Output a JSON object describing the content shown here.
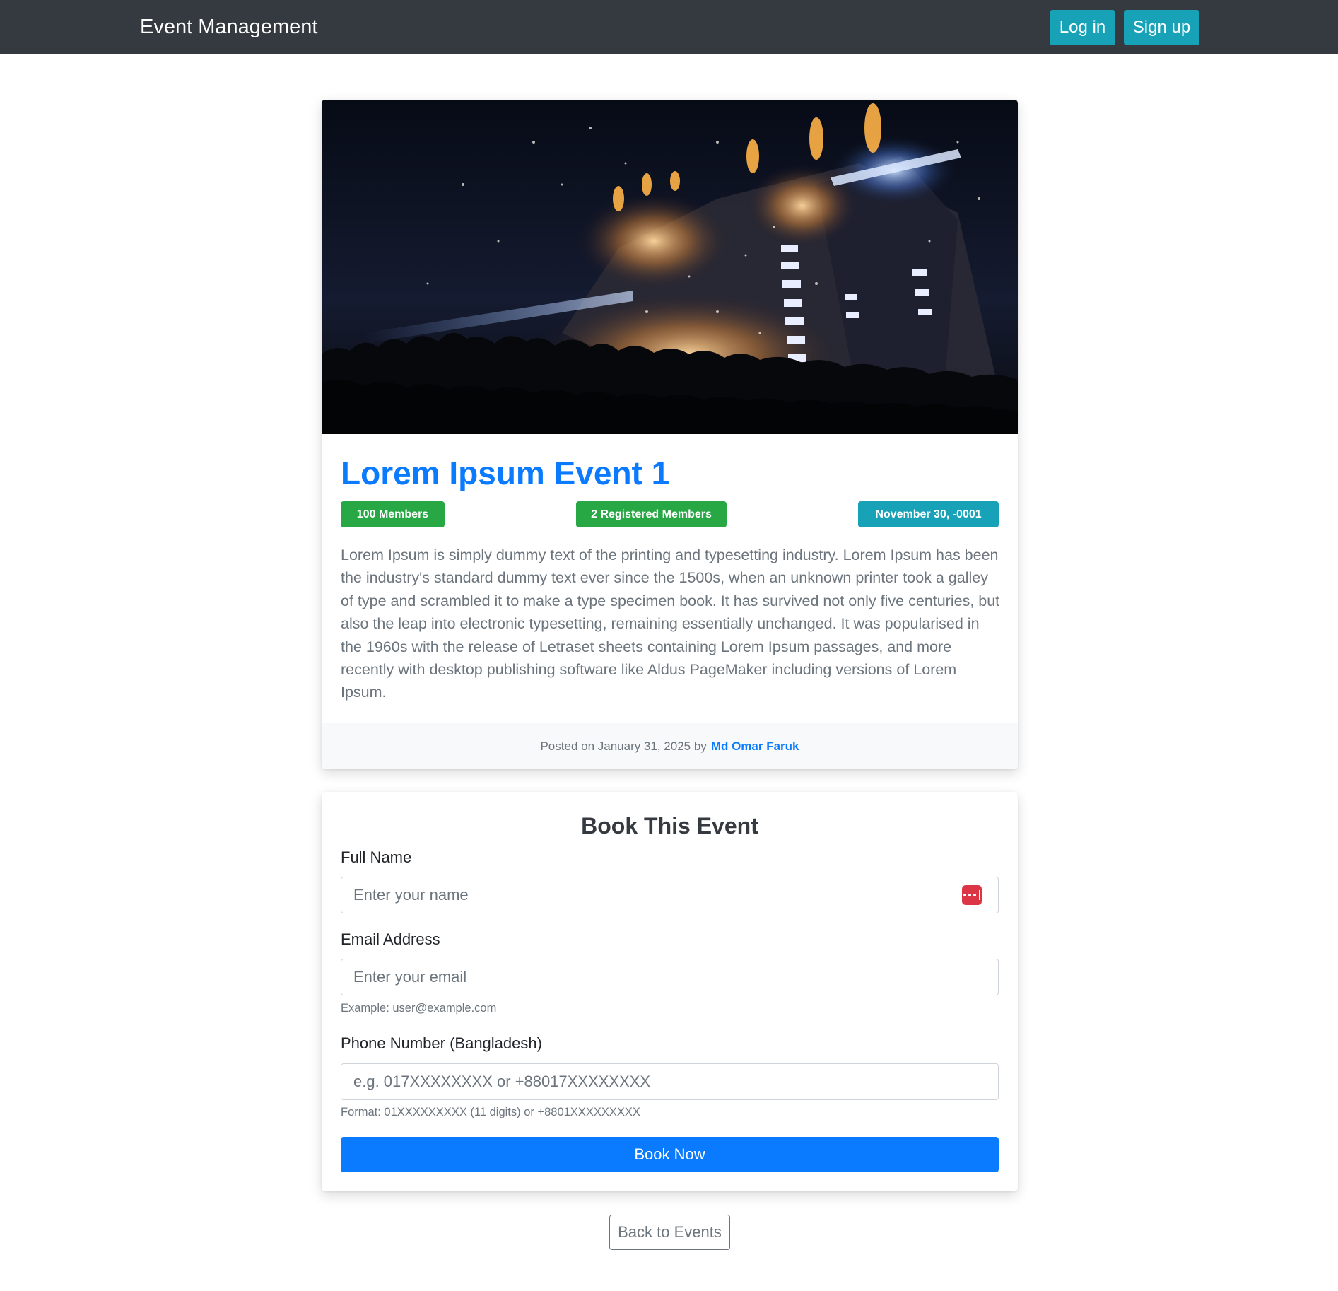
{
  "navbar": {
    "brand": "Event Management",
    "login_label": "Log in",
    "signup_label": "Sign up"
  },
  "event": {
    "title": "Lorem Ipsum Event 1",
    "members_badge": "100 Members",
    "registered_badge": "2 Registered Members",
    "date_badge": "November 30, -0001",
    "description": "Lorem Ipsum is simply dummy text of the printing and typesetting industry. Lorem Ipsum has been the industry's standard dummy text ever since the 1500s, when an unknown printer took a galley of type and scrambled it to make a type specimen book. It has survived not only five centuries, but also the leap into electronic typesetting, remaining essentially unchanged. It was popularised in the 1960s with the release of Letraset sheets containing Lorem Ipsum passages, and more recently with desktop publishing software like Aldus PageMaker including versions of Lorem Ipsum.",
    "posted_prefix": "Posted on January 31, 2025 by",
    "author": "Md Omar Faruk",
    "image_icon": "concert-stage-image"
  },
  "booking": {
    "title": "Book This Event",
    "name_label": "Full Name",
    "name_placeholder": "Enter your name",
    "email_label": "Email Address",
    "email_placeholder": "Enter your email",
    "email_hint": "Example: user@example.com",
    "phone_label": "Phone Number (Bangladesh)",
    "phone_placeholder": "e.g. 017XXXXXXXX or +88017XXXXXXXX",
    "phone_hint": "Format: 01XXXXXXXXX (11 digits) or +8801XXXXXXXXX",
    "submit_label": "Book Now",
    "password_manager_icon": "password-manager-icon"
  },
  "back_label": "Back to Events",
  "colors": {
    "navbar": "#343a40",
    "info": "#17a2b8",
    "success": "#28a745",
    "primary": "#0a7bff",
    "danger": "#dc3545"
  }
}
